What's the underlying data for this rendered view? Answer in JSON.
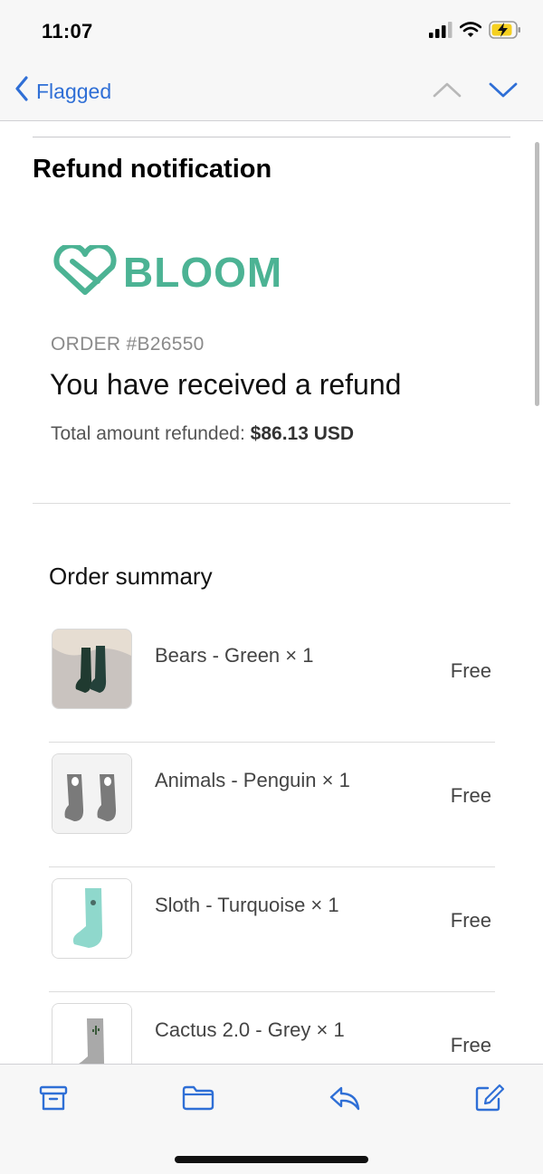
{
  "status_bar": {
    "time": "11:07",
    "icons": [
      "cellular-signal-icon",
      "wifi-icon",
      "battery-charging-icon"
    ]
  },
  "nav": {
    "back_label": "Flagged",
    "icons": [
      "chevron-left-icon",
      "chevron-up-icon",
      "chevron-down-icon"
    ]
  },
  "email": {
    "subject": "Refund notification",
    "brand": "BLOOM",
    "brand_color": "#4cb394",
    "order_number": "ORDER #B26550",
    "headline": "You have received a refund",
    "total_label": "Total amount refunded: ",
    "total_amount": "$86.13 USD",
    "summary_title": "Order summary",
    "items": [
      {
        "name": "Bears - Green × 1",
        "price": "Free",
        "image": "green-socks-image"
      },
      {
        "name": "Animals - Penguin × 1",
        "price": "Free",
        "image": "grey-penguin-socks-image"
      },
      {
        "name": "Sloth - Turquoise × 1",
        "price": "Free",
        "image": "turquoise-sock-image"
      },
      {
        "name": "Cactus 2.0 - Grey × 1",
        "price": "Free",
        "image": "grey-cactus-sock-image"
      }
    ]
  },
  "toolbar": {
    "icons": [
      "archive-icon",
      "folder-icon",
      "reply-icon",
      "compose-icon"
    ],
    "accent_color": "#2f6fd6"
  }
}
